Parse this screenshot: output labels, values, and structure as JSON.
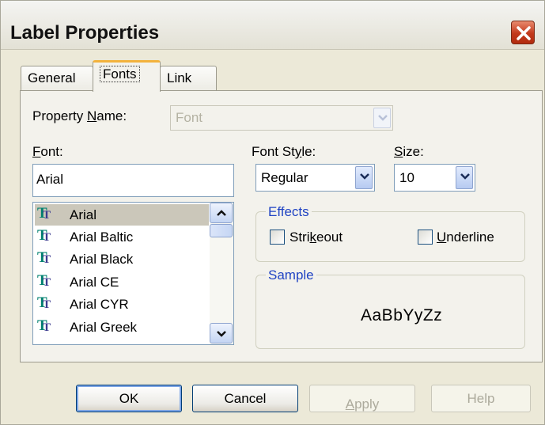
{
  "window": {
    "title": "Label Properties"
  },
  "tabs": [
    {
      "label": "General"
    },
    {
      "label": "Fonts"
    },
    {
      "label": "Link"
    }
  ],
  "property_name": {
    "label_pre": "Property ",
    "label_u": "N",
    "label_post": "ame:",
    "value": "Font"
  },
  "font": {
    "label_u": "F",
    "label_post": "ont:",
    "value": "Arial",
    "list": [
      "Arial",
      "Arial Baltic",
      "Arial Black",
      "Arial CE",
      "Arial CYR",
      "Arial Greek"
    ],
    "selected": "Arial"
  },
  "font_style": {
    "label_pre": "Font St",
    "label_u": "y",
    "label_post": "le:",
    "value": "Regular"
  },
  "size": {
    "label_u": "S",
    "label_post": "ize:",
    "value": "10"
  },
  "effects": {
    "title": "Effects",
    "strikeout": {
      "pre": "Stri",
      "u": "k",
      "post": "eout",
      "checked": false
    },
    "underline": {
      "pre": "",
      "u": "U",
      "post": "nderline",
      "checked": false
    }
  },
  "sample": {
    "title": "Sample",
    "text": "AaBbYyZz"
  },
  "buttons": {
    "ok": "OK",
    "cancel": "Cancel",
    "apply_u": "A",
    "apply_post": "pply",
    "help": "Help"
  },
  "font_icon": "truetype-font-icon"
}
